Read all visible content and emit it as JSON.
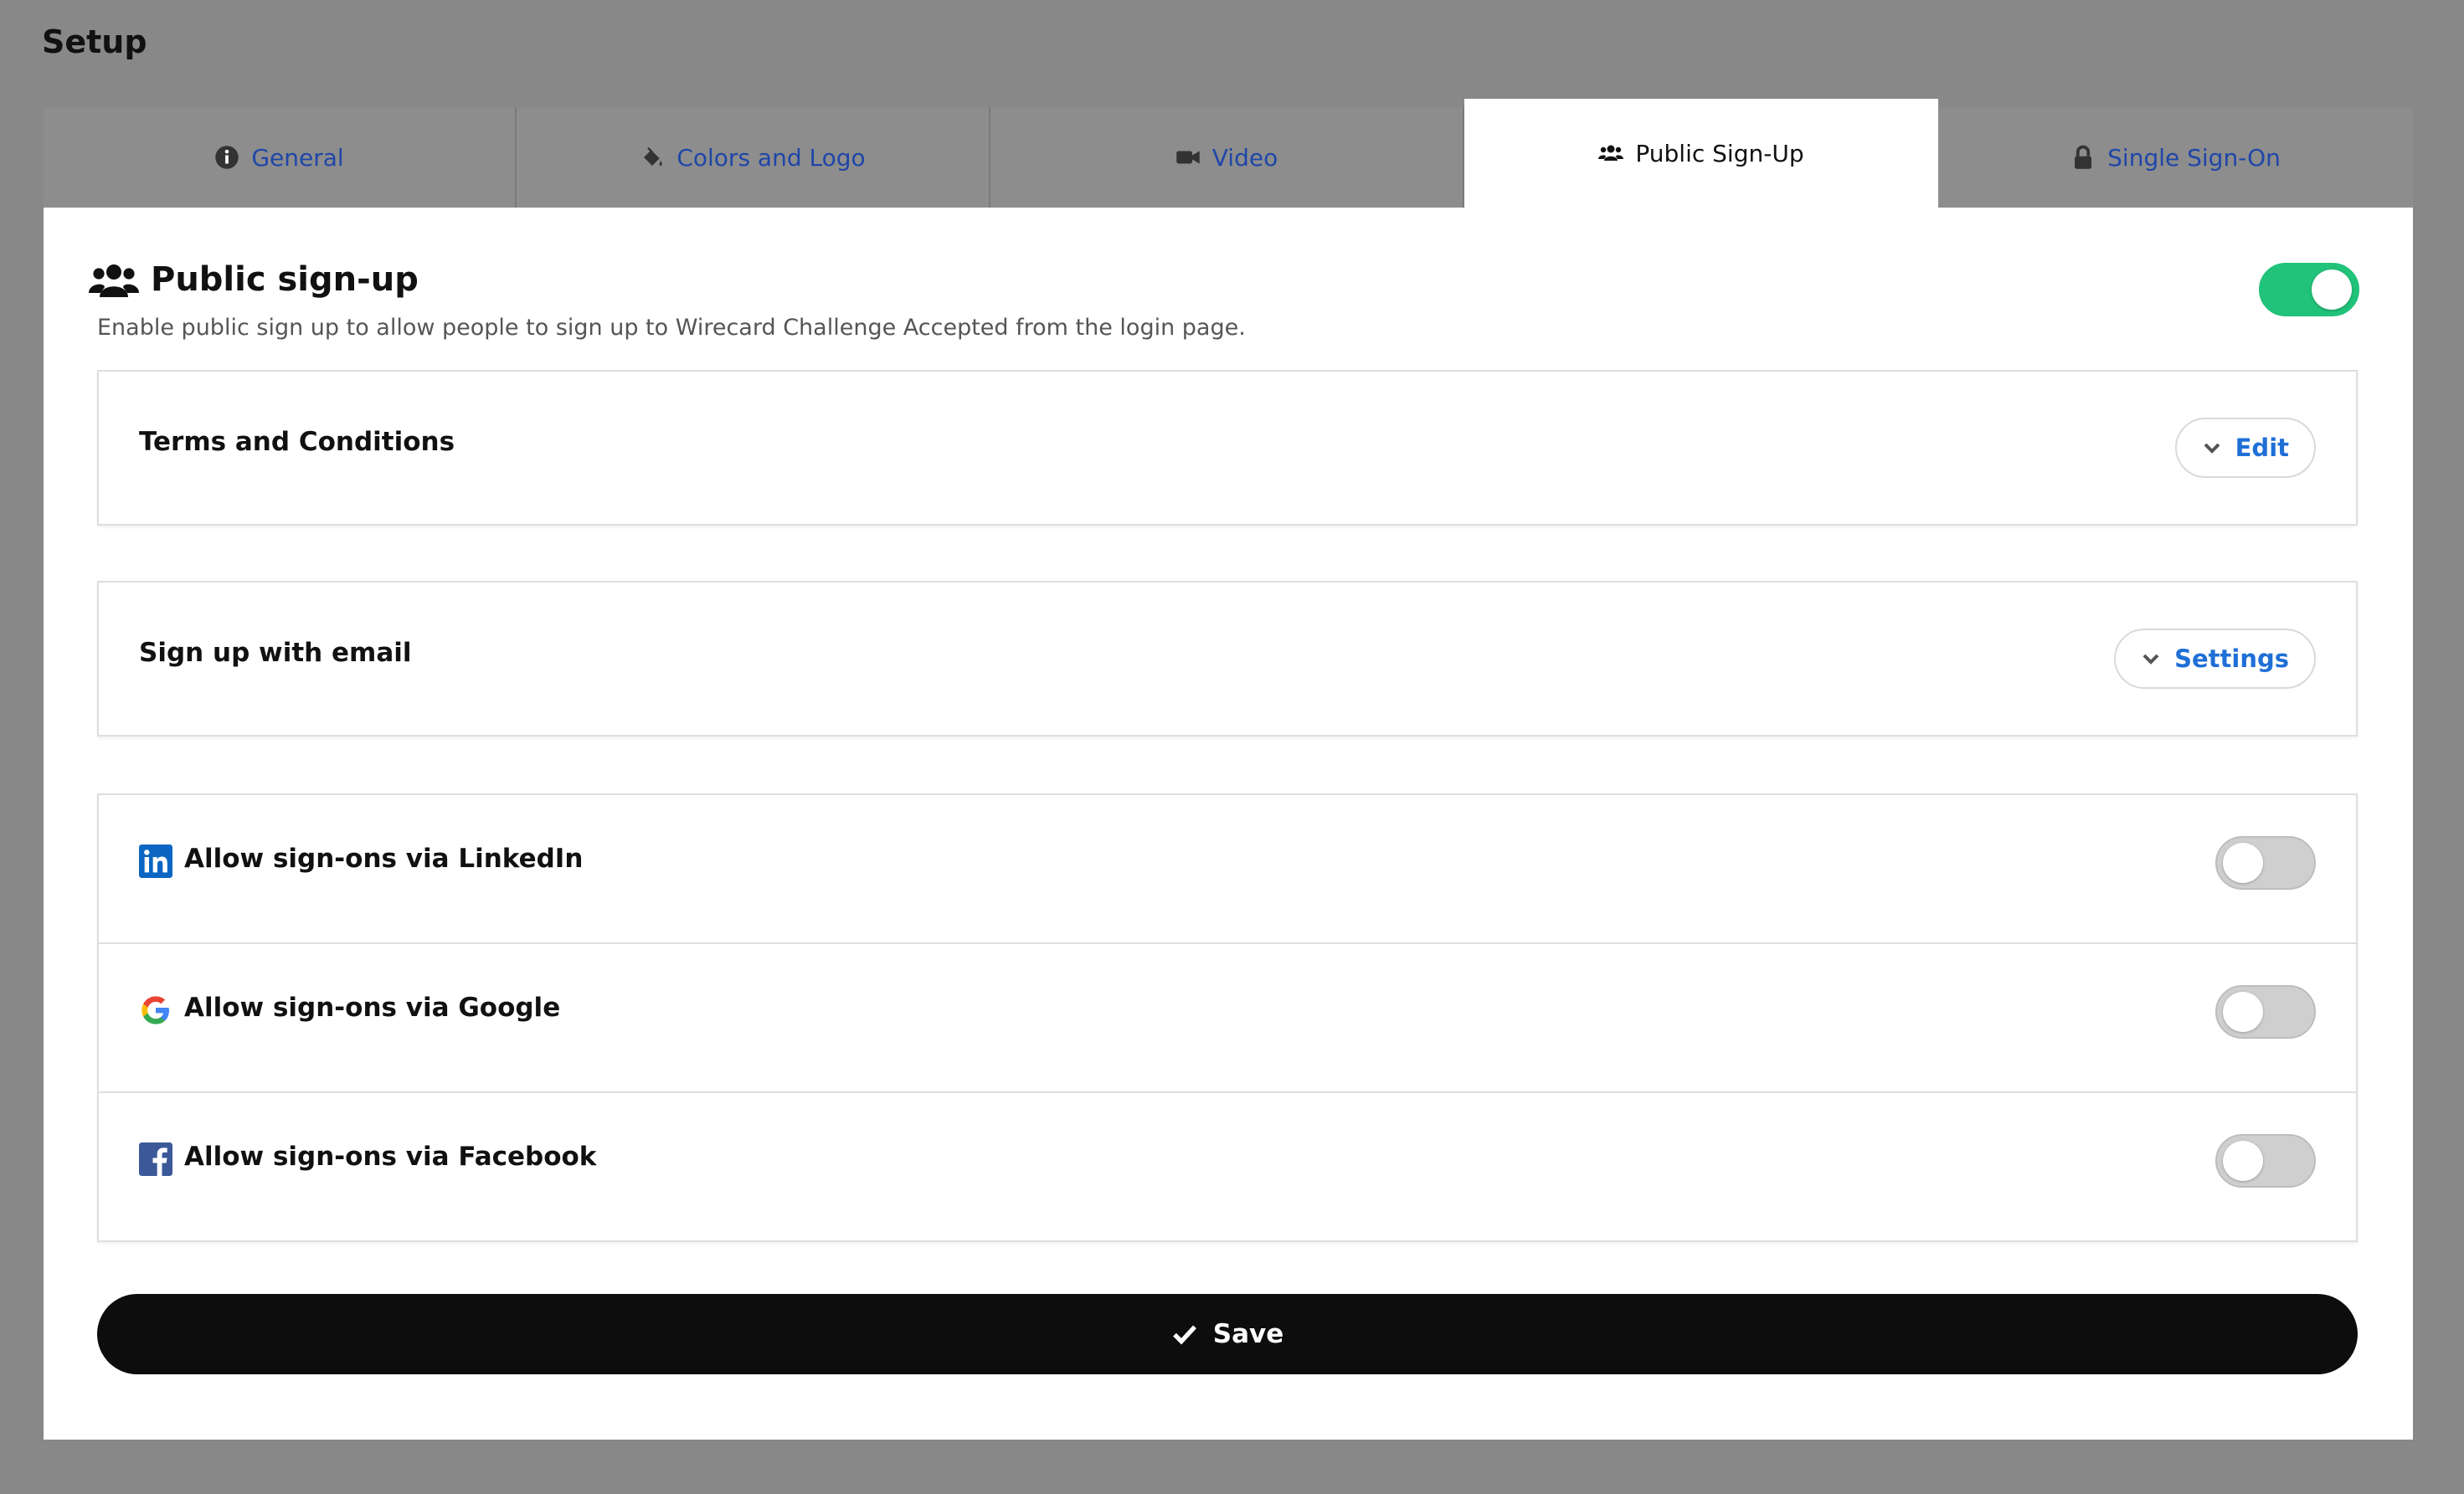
{
  "page": {
    "title": "Setup"
  },
  "tabs": [
    {
      "label": "General",
      "icon": "info-circle-icon"
    },
    {
      "label": "Colors and Logo",
      "icon": "paint-bucket-icon"
    },
    {
      "label": "Video",
      "icon": "video-camera-icon"
    },
    {
      "label": "Public Sign-Up",
      "icon": "users-icon",
      "active": true
    },
    {
      "label": "Single Sign-On",
      "icon": "lock-icon"
    }
  ],
  "section": {
    "title": "Public sign-up",
    "description": "Enable public sign up to allow people to sign up to Wirecard Challenge Accepted from the login page.",
    "enabled": true
  },
  "terms": {
    "label": "Terms and Conditions",
    "button_label": "Edit"
  },
  "email_signup": {
    "label": "Sign up with email",
    "button_label": "Settings"
  },
  "social": [
    {
      "label": "Allow sign-ons via LinkedIn",
      "icon": "linkedin-icon",
      "enabled": false
    },
    {
      "label": "Allow sign-ons via Google",
      "icon": "google-icon",
      "enabled": false
    },
    {
      "label": "Allow sign-ons via Facebook",
      "icon": "facebook-icon",
      "enabled": false
    }
  ],
  "save": {
    "label": "Save"
  },
  "colors": {
    "accent": "#21c27a",
    "link": "#1f6fd6",
    "primary_button": "#0d0d0d",
    "backdrop": "#888888"
  }
}
